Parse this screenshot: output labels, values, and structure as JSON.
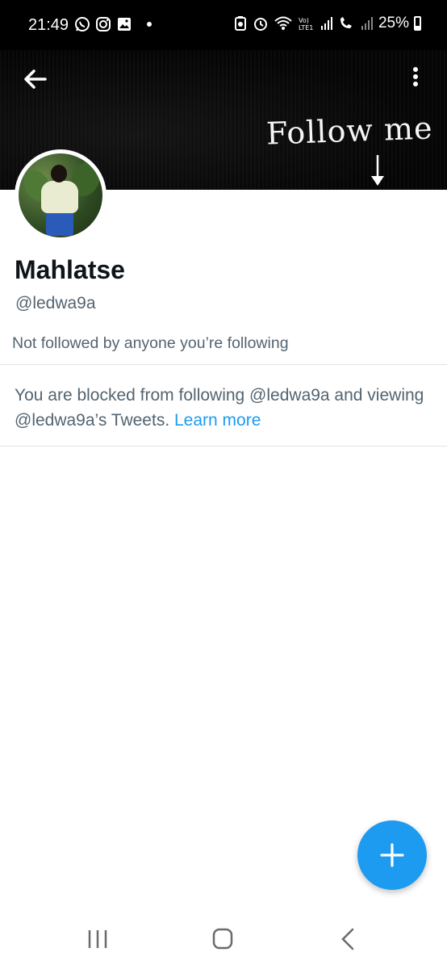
{
  "status_bar": {
    "time": "21:49",
    "battery_percent": "25%",
    "left_icons": [
      "whatsapp-icon",
      "instagram-icon",
      "gallery-icon"
    ],
    "right_icons": [
      "battery-saver-icon",
      "alarm-icon",
      "wifi-icon",
      "volte-icon",
      "signal-icon",
      "call-icon",
      "signal-icon"
    ]
  },
  "banner": {
    "text": "Follow me"
  },
  "profile": {
    "name": "Mahlatse",
    "handle": "@ledwa9a",
    "followed_by": "Not followed by anyone you’re following"
  },
  "blocked_notice": {
    "text": "You are blocked from following @ledwa9a and viewing @ledwa9a’s Tweets.",
    "link": "Learn more"
  },
  "colors": {
    "accent": "#1d9bf0",
    "text_primary": "#0f1419",
    "text_secondary": "#536471"
  },
  "fab": {
    "icon": "plus-icon"
  },
  "nav_bar": {
    "icons": [
      "recent-apps-icon",
      "home-icon",
      "back-icon"
    ]
  }
}
